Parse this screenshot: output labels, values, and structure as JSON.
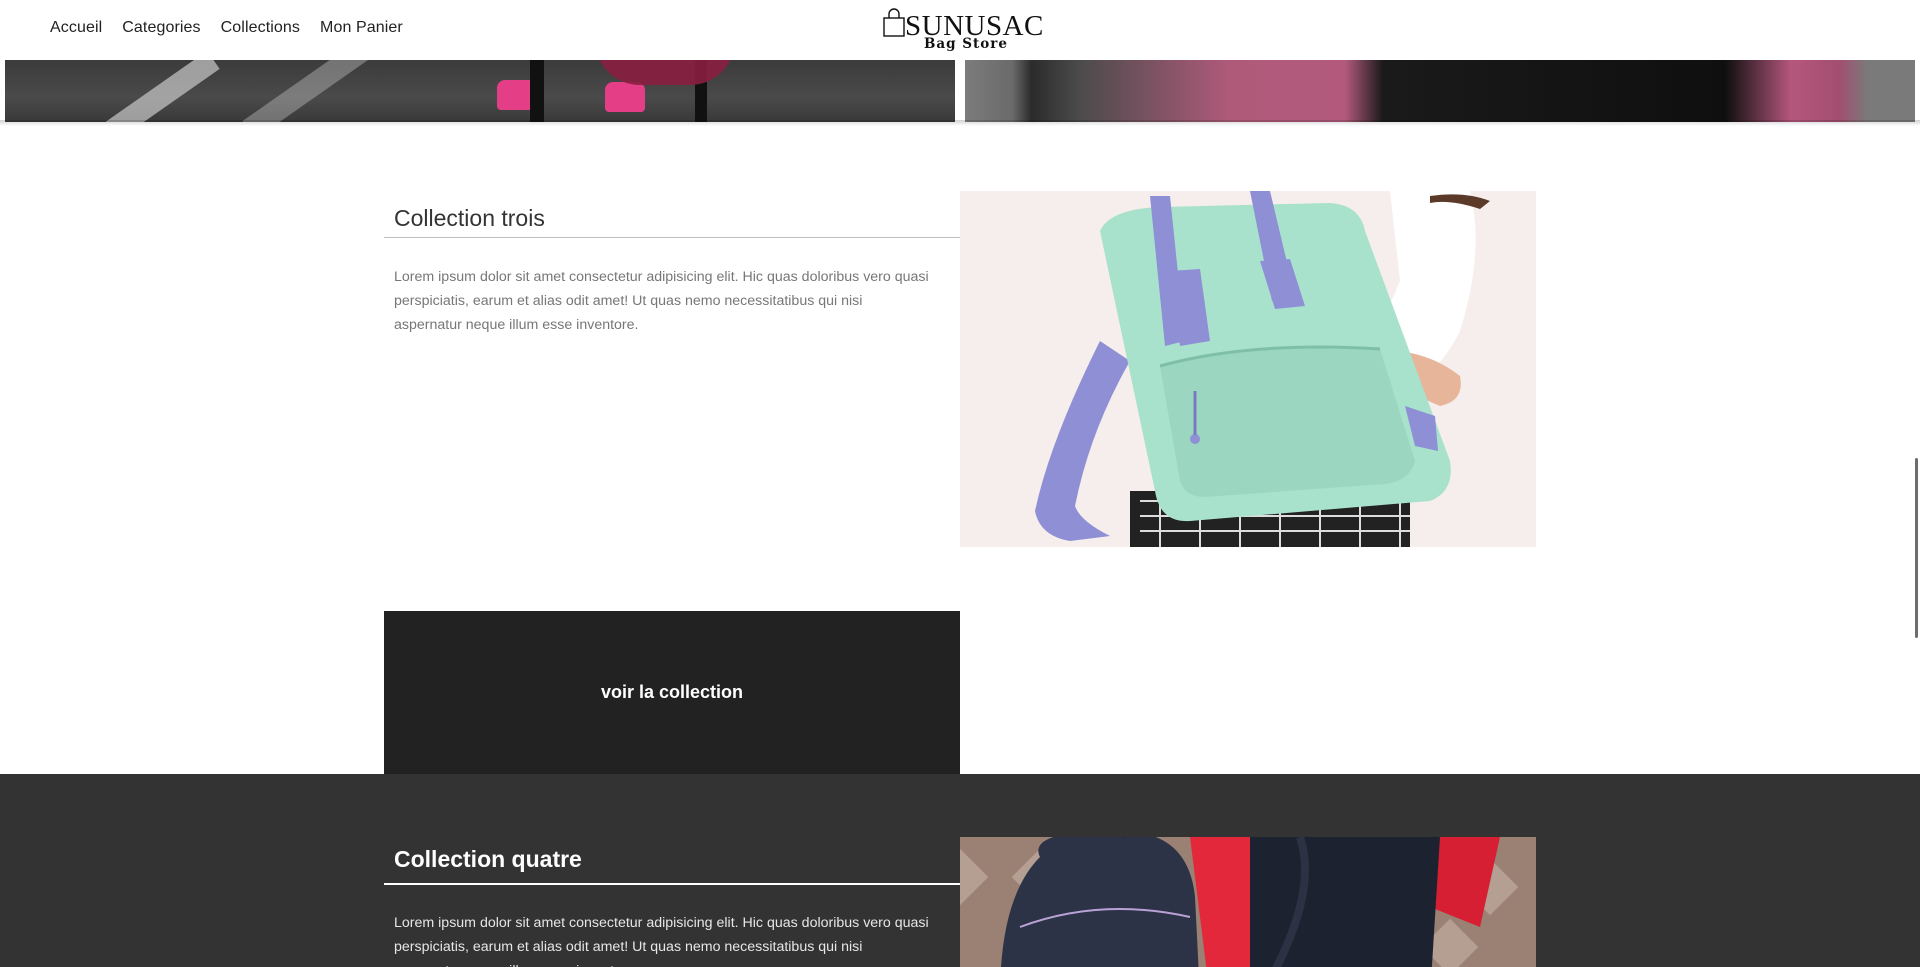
{
  "nav": {
    "items": [
      "Accueil",
      "Categories",
      "Collections",
      "Mon Panier"
    ]
  },
  "logo": {
    "brand": "SUNUSAC",
    "subtitle": "Bag Store"
  },
  "collection3": {
    "title": "Collection trois",
    "description": "Lorem ipsum dolor sit amet consectetur adipisicing elit. Hic quas doloribus vero quasi perspiciatis, earum et alias odit amet! Ut quas nemo necessitatibus qui nisi aspernatur neque illum esse inventore.",
    "cta_label": "voir la collection"
  },
  "collection4": {
    "title": "Collection quatre",
    "description": "Lorem ipsum dolor sit amet consectetur adipisicing elit. Hic quas doloribus vero quasi perspiciatis, earum et alias odit amet! Ut quas nemo necessitatibus qui nisi aspernatur neque illum esse inventore."
  },
  "colors": {
    "header_bg": "#ffffff",
    "cta_bg": "#222222",
    "dark_section_bg": "#333333",
    "text_muted": "#777777",
    "backpack_mint": "#a9e2cc",
    "backpack_strap": "#8f8fd6"
  }
}
